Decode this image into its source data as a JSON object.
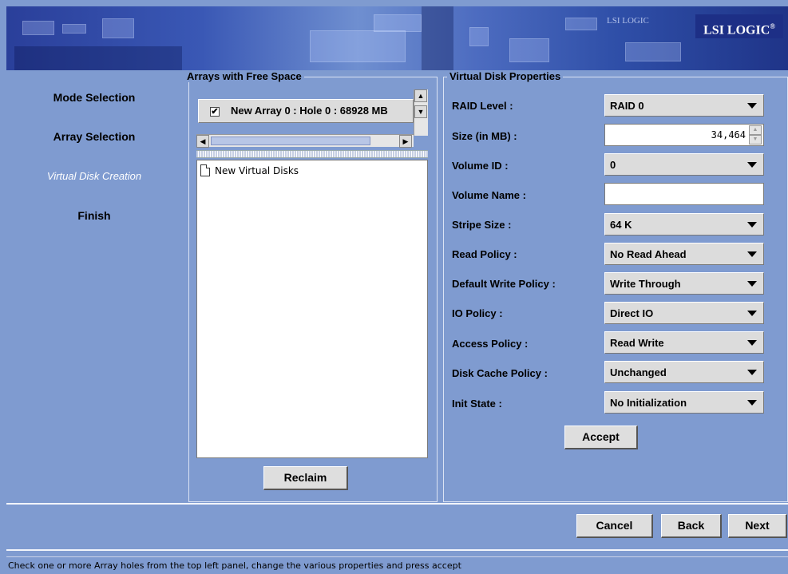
{
  "banner": {
    "brand": "LSI LOGIC",
    "registered": "®",
    "ghost_text": "LSI LOGIC"
  },
  "sidebar": {
    "steps": [
      {
        "label": "Mode Selection",
        "active": false
      },
      {
        "label": "Array Selection",
        "active": false
      },
      {
        "label": "Virtual Disk Creation",
        "active": true
      },
      {
        "label": "Finish",
        "active": false
      }
    ]
  },
  "arrays_panel": {
    "title": "Arrays with Free Space",
    "items": [
      {
        "label": "New Array 0 : Hole 0 : 68928 MB",
        "checked": true
      }
    ],
    "tree_item": "New Virtual Disks",
    "reclaim_label": "Reclaim"
  },
  "properties": {
    "title": "Virtual Disk Properties",
    "raid_level": {
      "label": "RAID Level :",
      "value": "RAID 0"
    },
    "size": {
      "label": "Size (in MB) :",
      "value": "34,464"
    },
    "volume_id": {
      "label": "Volume ID :",
      "value": "0"
    },
    "volume_name": {
      "label": "Volume Name :",
      "value": ""
    },
    "stripe_size": {
      "label": "Stripe Size :",
      "value": "64 K"
    },
    "read_policy": {
      "label": "Read Policy :",
      "value": "No Read Ahead"
    },
    "write_policy": {
      "label": "Default Write Policy :",
      "value": "Write Through"
    },
    "io_policy": {
      "label": "IO Policy :",
      "value": "Direct IO"
    },
    "access_policy": {
      "label": "Access Policy :",
      "value": "Read Write"
    },
    "disk_cache_policy": {
      "label": "Disk Cache Policy :",
      "value": "Unchanged"
    },
    "init_state": {
      "label": "Init State :",
      "value": "No Initialization"
    },
    "accept_label": "Accept"
  },
  "footer": {
    "cancel_label": "Cancel",
    "back_label": "Back",
    "next_label": "Next"
  },
  "status_bar": {
    "text": "Check one or more Array holes from the top left panel, change the various properties and press accept"
  },
  "colors": {
    "background": "#7f9bd0",
    "active_step": "#ffffff"
  }
}
